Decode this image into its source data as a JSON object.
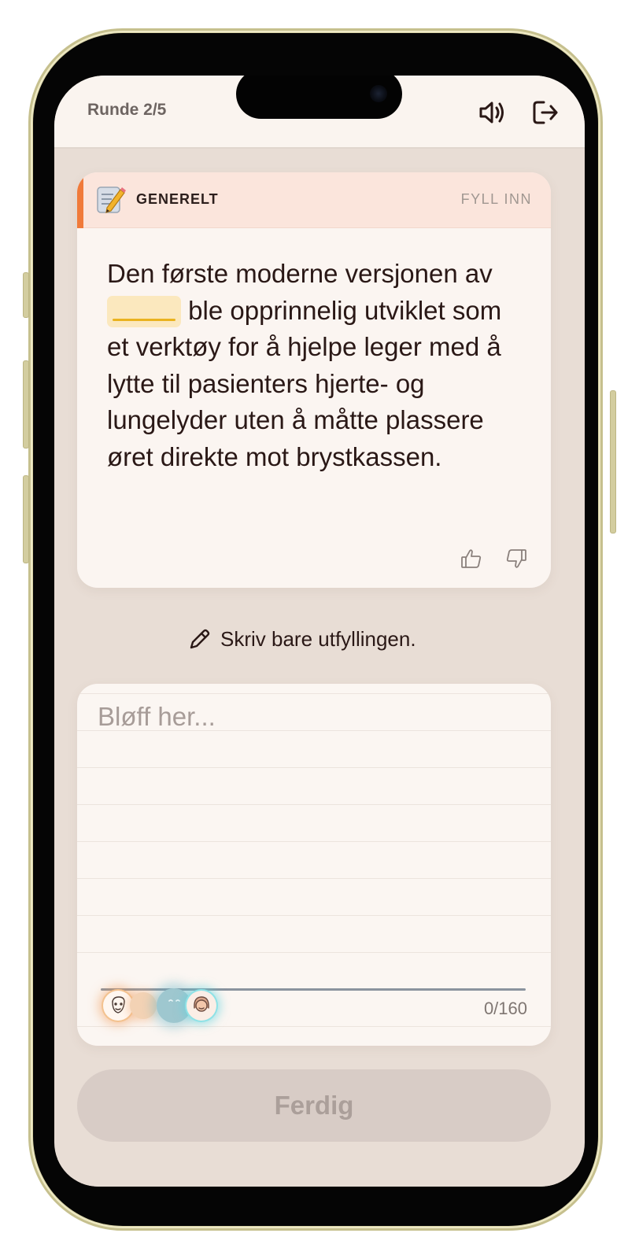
{
  "header": {
    "round": "Runde 2/5",
    "sound_icon": "speaker-icon",
    "exit_icon": "exit-icon"
  },
  "question": {
    "category": "GENERELT",
    "category_icon": "memo-pencil-icon",
    "type": "FYLL INN",
    "text_before": "Den første moderne versjonen av",
    "text_after": "ble opprinnelig utviklet som et verktøy for å hjelpe leger med å lytte til pasienters hjerte- og lungelyder uten å måtte plassere øret direkte mot brystkassen.",
    "feedback_icons": [
      "thumbs-up-icon",
      "thumbs-down-icon"
    ]
  },
  "hint": {
    "icon": "pencil-icon",
    "text": "Skriv bare utfyllingen."
  },
  "answer": {
    "placeholder": "Bløff her...",
    "value": "",
    "char_count": "0/160",
    "max_chars": 160,
    "players": [
      "player-avatar-1",
      "player-avatar-2",
      "player-avatar-3",
      "player-avatar-4"
    ]
  },
  "submit": {
    "label": "Ferdig",
    "enabled": false
  },
  "colors": {
    "accent": "#f07a3a",
    "blank_fill": "#fbe8be",
    "blank_line": "#eab31f",
    "background": "#e8ddd5",
    "card": "#fbf5f1"
  }
}
